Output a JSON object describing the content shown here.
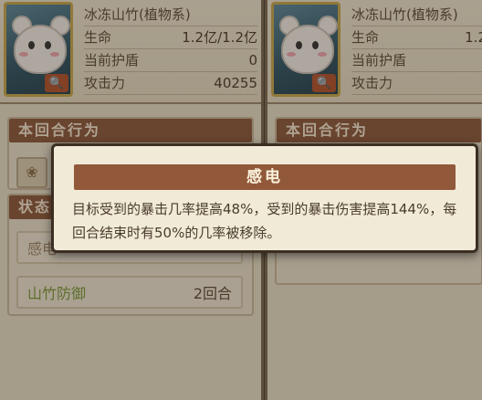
{
  "left_card": {
    "name": "冰冻山竹(植物系)",
    "stats": [
      {
        "label": "生命",
        "value": "1.2亿/1.2亿"
      },
      {
        "label": "当前护盾",
        "value": "0"
      },
      {
        "label": "攻击力",
        "value": "40255"
      }
    ],
    "action_title": "本回合行为",
    "status_title": "状态",
    "buffs": [
      {
        "name": "感电",
        "duration": ""
      },
      {
        "name": "山竹防御",
        "duration": "2回合"
      }
    ]
  },
  "right_card": {
    "name": "冰冻山竹(植物系)",
    "stats": [
      {
        "label": "生命",
        "value": "1.2"
      },
      {
        "label": "当前护盾",
        "value": ""
      },
      {
        "label": "攻击力",
        "value": ""
      }
    ],
    "action_title": "本回合行为"
  },
  "tooltip": {
    "title": "感电",
    "description": "目标受到的暴击几率提高48%，受到的暴击伤害提高144%，每回合结束时有50%的几率被移除。"
  },
  "colors": {
    "title_bar": "#8d5a3c",
    "buff_green": "#7b9a3a"
  },
  "icons": [
    "search-icon",
    "lotus-icon"
  ]
}
